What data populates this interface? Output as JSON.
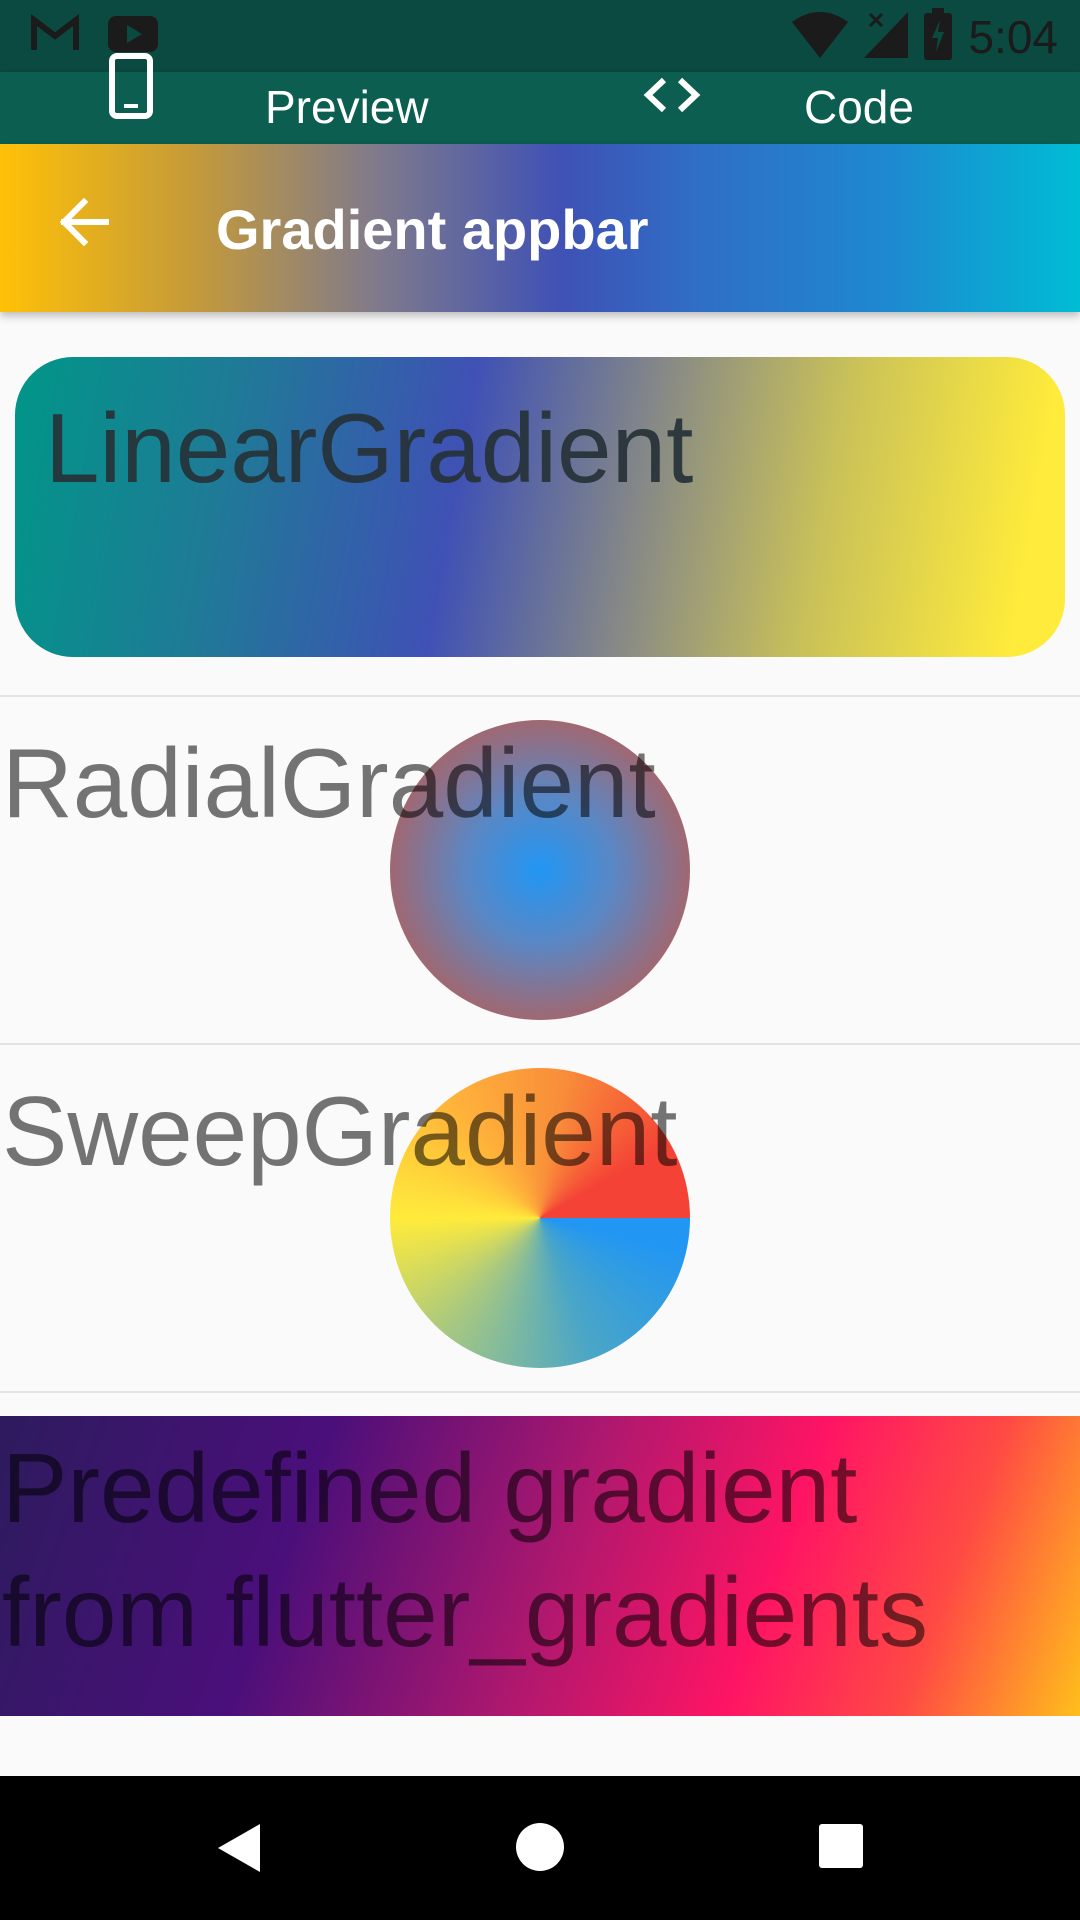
{
  "status_bar": {
    "time": "5:04",
    "icons": [
      "gmail-icon",
      "youtube-icon",
      "wifi-icon",
      "signal-icon",
      "battery-icon"
    ]
  },
  "tab_bar": {
    "preview_label": "Preview",
    "code_label": "Code",
    "icons": [
      "phone-icon",
      "code-brackets-icon"
    ]
  },
  "appbar": {
    "title": "Gradient appbar",
    "back_icon": "arrow-back-icon"
  },
  "sections": {
    "linear": {
      "label": "LinearGradient"
    },
    "radial": {
      "label": "RadialGradient"
    },
    "sweep": {
      "label": "SweepGradient"
    },
    "predefined": {
      "line1": "Predefined gradient",
      "line2": "from flutter_gradients"
    }
  },
  "nav_bar": {
    "icons": [
      "nav-back-icon",
      "nav-home-icon",
      "nav-recents-icon"
    ]
  },
  "colors": {
    "status_bar": "#0a4a40",
    "tab_bar": "#0b5e50",
    "background": "#fafafa",
    "appbar_gradient": [
      "#ffc107",
      "#3f51b5",
      "#00bcd4"
    ],
    "linear_gradient": [
      "#009688",
      "#3f51b5",
      "#ffeb3b"
    ],
    "radial_gradient": [
      "#2196f3",
      "#b25a6a"
    ],
    "sweep_gradient": [
      "#2196f3",
      "#ffeb3b",
      "#f44336"
    ],
    "predefined_gradient": [
      "#2d1b5e",
      "#ff1464",
      "#ffbf1c"
    ]
  }
}
